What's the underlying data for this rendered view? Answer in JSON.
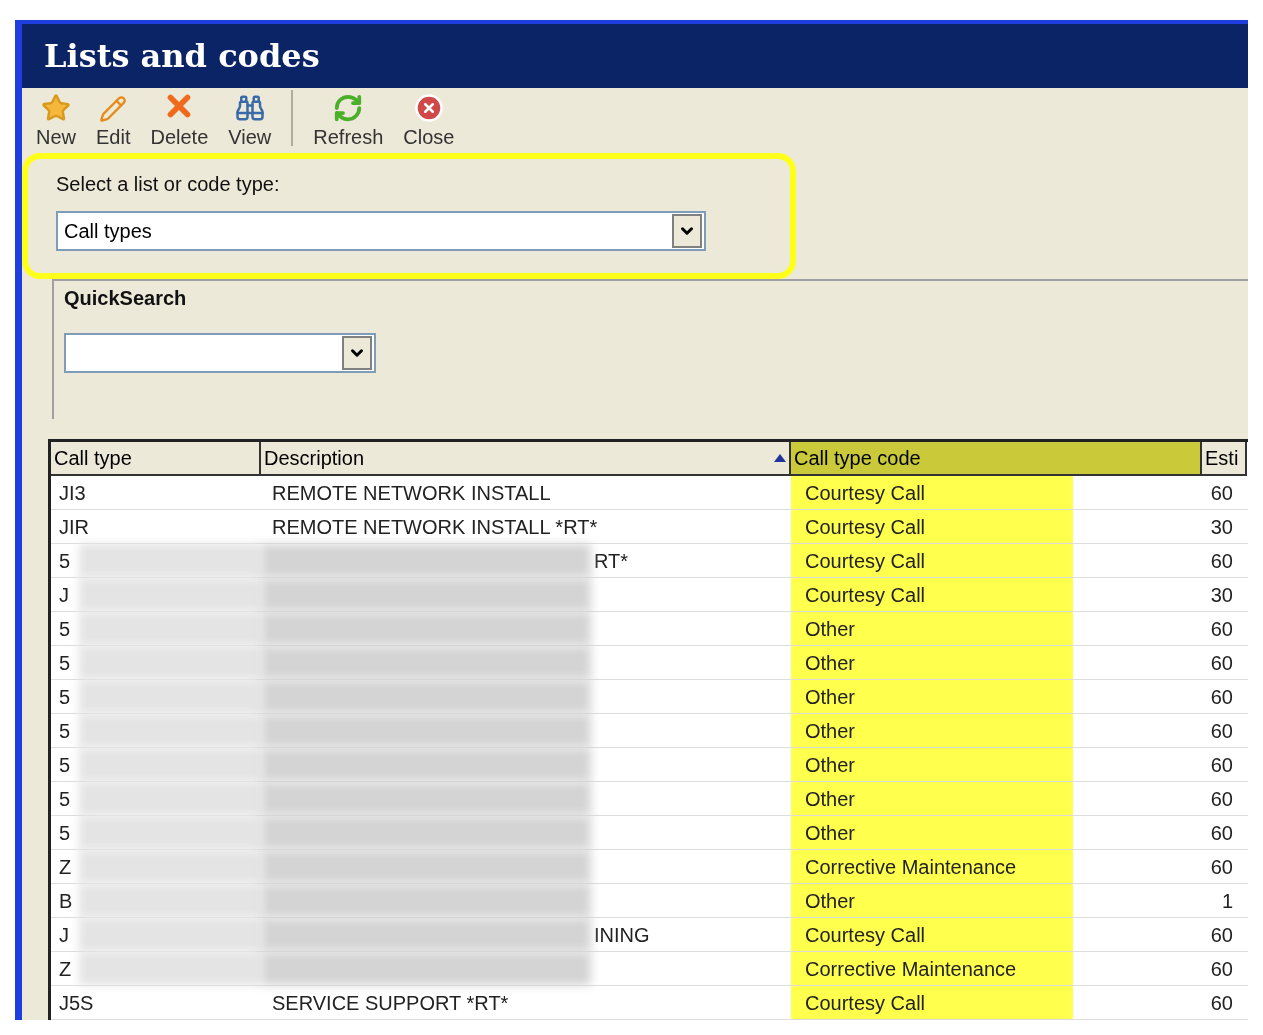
{
  "window": {
    "title": "Lists and codes"
  },
  "toolbar": [
    {
      "label": "New",
      "kind": "new"
    },
    {
      "label": "Edit",
      "kind": "edit"
    },
    {
      "label": "Delete",
      "kind": "delete"
    },
    {
      "label": "View",
      "kind": "view"
    },
    {
      "label": "Refresh",
      "kind": "refresh"
    },
    {
      "label": "Close",
      "kind": "close"
    }
  ],
  "type_select": {
    "label": "Select a list or code type:",
    "value": "Call types"
  },
  "quick_search": {
    "label": "QuickSearch"
  },
  "table": {
    "columns": [
      {
        "label": "Call type",
        "sorted": false,
        "highlighted": false
      },
      {
        "label": "Description",
        "sorted": true,
        "highlighted": false
      },
      {
        "label": "Call type code",
        "sorted": false,
        "highlighted": true
      },
      {
        "label": "Esti",
        "sorted": false,
        "highlighted": false
      }
    ],
    "rows": [
      {
        "call_type": "JI3",
        "description": "REMOTE NETWORK INSTALL",
        "code": "Courtesy Call",
        "estimate": "60",
        "redacted": false
      },
      {
        "call_type": "JIR",
        "description": "REMOTE NETWORK INSTALL *RT*",
        "code": "Courtesy Call",
        "estimate": "30",
        "redacted": false
      },
      {
        "call_type": "5",
        "description": "RT*",
        "code": "Courtesy Call",
        "estimate": "60",
        "redacted": true
      },
      {
        "call_type": "J",
        "code": "Courtesy Call",
        "estimate": "30",
        "redacted": true
      },
      {
        "call_type": "5",
        "code": "Other",
        "estimate": "60",
        "redacted": true
      },
      {
        "call_type": "5",
        "code": "Other",
        "estimate": "60",
        "redacted": true
      },
      {
        "call_type": "5",
        "code": "Other",
        "estimate": "60",
        "redacted": true
      },
      {
        "call_type": "5",
        "code": "Other",
        "estimate": "60",
        "redacted": true
      },
      {
        "call_type": "5",
        "code": "Other",
        "estimate": "60",
        "redacted": true
      },
      {
        "call_type": "5",
        "code": "Other",
        "estimate": "60",
        "redacted": true
      },
      {
        "call_type": "5",
        "code": "Other",
        "estimate": "60",
        "redacted": true
      },
      {
        "call_type": "Z",
        "code": "Corrective Maintenance",
        "estimate": "60",
        "redacted": true
      },
      {
        "call_type": "B",
        "code": "Other",
        "estimate": "1",
        "redacted": true
      },
      {
        "call_type": "J",
        "description": "INING",
        "code": "Courtesy Call",
        "estimate": "60",
        "redacted": true
      },
      {
        "call_type": "Z",
        "code": "Corrective Maintenance",
        "estimate": "60",
        "redacted": true
      },
      {
        "call_type": "J5S",
        "description": "SERVICE SUPPORT *RT*",
        "code": "Courtesy Call",
        "estimate": "60",
        "redacted": false
      }
    ]
  }
}
